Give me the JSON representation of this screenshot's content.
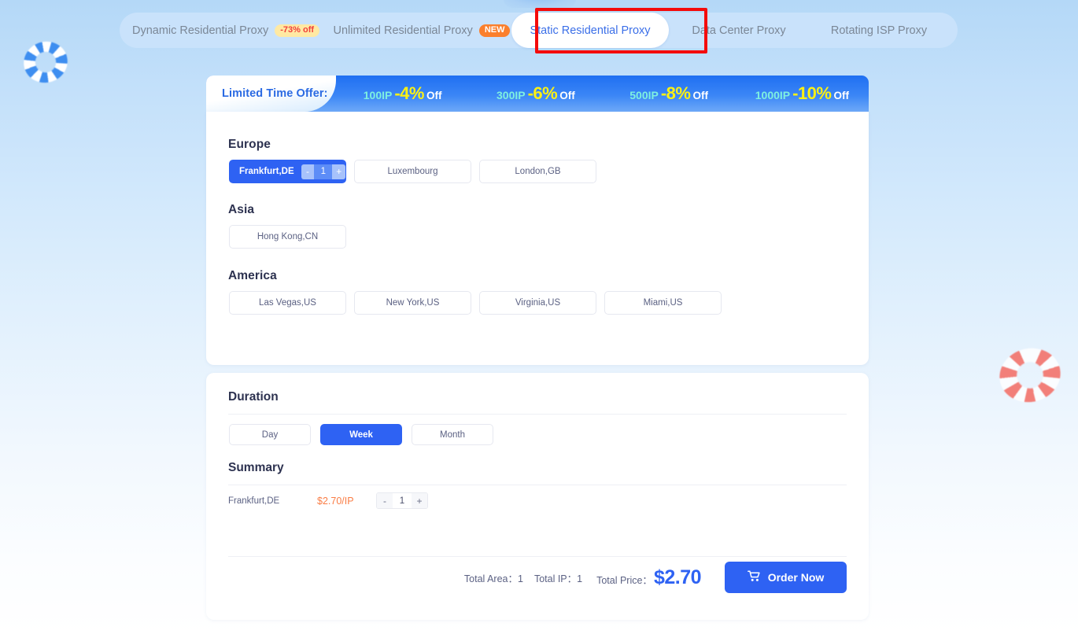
{
  "tabs": [
    {
      "label": "Dynamic Residential Proxy",
      "badge": "-73% off",
      "badge_kind": "off",
      "active": false
    },
    {
      "label": "Unlimited Residential Proxy",
      "badge": "NEW",
      "badge_kind": "new",
      "active": false
    },
    {
      "label": "Static Residential Proxy",
      "badge": "",
      "badge_kind": "",
      "active": true
    },
    {
      "label": "Data Center Proxy",
      "badge": "",
      "badge_kind": "",
      "active": false
    },
    {
      "label": "Rotating ISP Proxy",
      "badge": "",
      "badge_kind": "",
      "active": false
    }
  ],
  "promo": {
    "label": "Limited Time Offer:",
    "tiers": [
      {
        "ip": "100IP",
        "pct": "-4%",
        "off": "Off"
      },
      {
        "ip": "300IP",
        "pct": "-6%",
        "off": "Off"
      },
      {
        "ip": "500IP",
        "pct": "-8%",
        "off": "Off"
      },
      {
        "ip": "1000IP",
        "pct": "-10%",
        "off": "Off"
      }
    ]
  },
  "regions": [
    {
      "title": "Europe",
      "locations": [
        {
          "name": "Frankfurt,DE",
          "selected": true,
          "qty": "1",
          "minus": "-",
          "plus": "+"
        },
        {
          "name": "Luxembourg",
          "selected": false
        },
        {
          "name": "London,GB",
          "selected": false
        }
      ]
    },
    {
      "title": "Asia",
      "locations": [
        {
          "name": "Hong Kong,CN",
          "selected": false
        }
      ]
    },
    {
      "title": "America",
      "locations": [
        {
          "name": "Las Vegas,US",
          "selected": false
        },
        {
          "name": "New York,US",
          "selected": false
        },
        {
          "name": "Virginia,US",
          "selected": false
        },
        {
          "name": "Miami,US",
          "selected": false
        }
      ]
    }
  ],
  "duration": {
    "heading": "Duration",
    "options": [
      {
        "label": "Day",
        "active": false
      },
      {
        "label": "Week",
        "active": true
      },
      {
        "label": "Month",
        "active": false
      }
    ]
  },
  "summary": {
    "heading": "Summary",
    "rows": [
      {
        "location": "Frankfurt,DE",
        "price": "$2.70/IP",
        "minus": "-",
        "qty": "1",
        "plus": "+"
      }
    ]
  },
  "totals": {
    "area_label": "Total Area：",
    "area_value": "1",
    "ip_label": "Total IP：",
    "ip_value": "1",
    "price_label": "Total Price：",
    "price_value": "$2.70",
    "order_button": "Order Now",
    "cart_icon": "shopping-cart-icon"
  },
  "colors": {
    "accent_blue": "#2e62f3",
    "tab_active_text": "#3b6fe8",
    "promo_yellow": "#fcf114",
    "promo_cyan": "#7ef0e0",
    "price_orange": "#fa7d45",
    "badge_off_bg": "#ffe9a3",
    "badge_off_text": "#f0403c",
    "badge_new_bg": "#fb7f2c",
    "highlight_red": "#f40b0b"
  },
  "decor": {
    "left_buoy": "lifebuoy-icon-blue",
    "right_buoy": "lifebuoy-icon-red"
  }
}
